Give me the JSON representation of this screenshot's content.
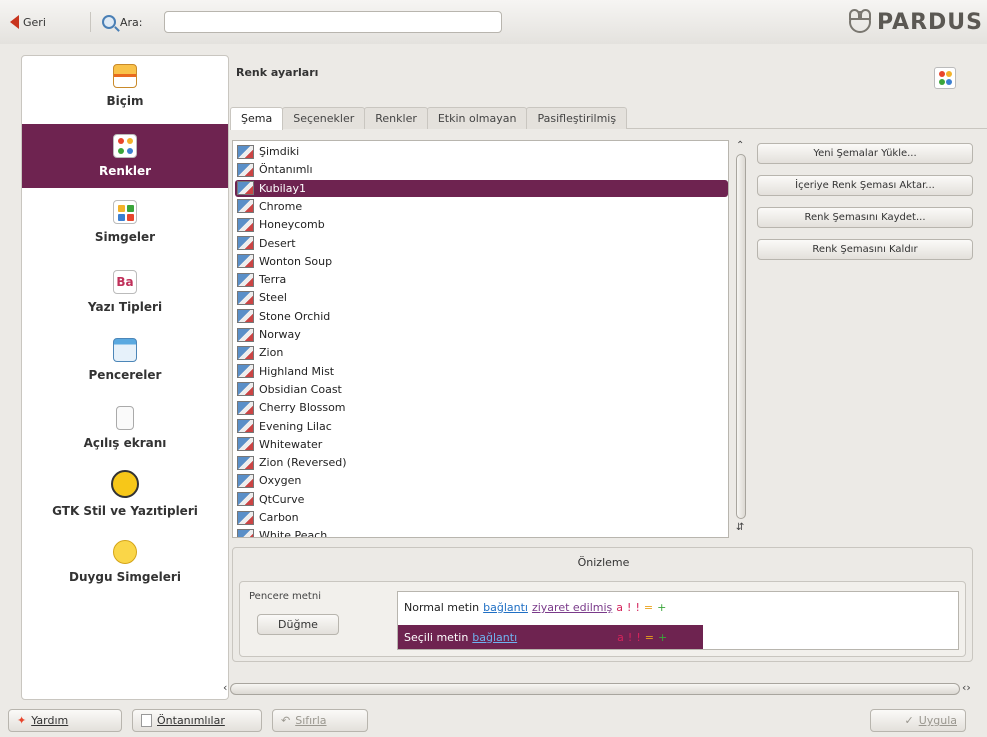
{
  "toolbar": {
    "back_label": "Geri",
    "search_label": "Ara:",
    "search_value": "",
    "brand": "PARDUS"
  },
  "sidebar": {
    "items": [
      {
        "label": "Biçim",
        "icon": "format-icon"
      },
      {
        "label": "Renkler",
        "icon": "colors-icon",
        "active": true
      },
      {
        "label": "Simgeler",
        "icon": "icons-icon"
      },
      {
        "label": "Yazı Tipleri",
        "icon": "fonts-icon"
      },
      {
        "label": "Pencereler",
        "icon": "windows-icon"
      },
      {
        "label": "Açılış ekranı",
        "icon": "splash-icon"
      },
      {
        "label": "GTK Stil ve Yazıtipleri",
        "icon": "gtk-icon"
      },
      {
        "label": "Duygu Simgeleri",
        "icon": "emoticons-icon"
      }
    ]
  },
  "main": {
    "title": "Renk ayarları",
    "tabs": [
      {
        "label": "Şema",
        "active": true
      },
      {
        "label": "Seçenekler"
      },
      {
        "label": "Renkler"
      },
      {
        "label": "Etkin olmayan"
      },
      {
        "label": "Pasifleştirilmiş"
      }
    ],
    "schemes": [
      "Şimdiki",
      "Öntanımlı",
      "Kubilay1",
      "Chrome",
      "Honeycomb",
      "Desert",
      "Wonton Soup",
      "Terra",
      "Steel",
      "Stone Orchid",
      "Norway",
      "Zion",
      "Highland Mist",
      "Obsidian Coast",
      "Cherry Blossom",
      "Evening Lilac",
      "Whitewater",
      "Zion (Reversed)",
      "Oxygen",
      "QtCurve",
      "Carbon",
      "White Peach"
    ],
    "selected_scheme": "Kubilay1",
    "actions": {
      "load": "Yeni Şemalar Yükle...",
      "import": "İçeriye Renk Şeması Aktar...",
      "save": "Renk Şemasını Kaydet...",
      "remove": "Renk Şemasını Kaldır"
    }
  },
  "preview": {
    "title": "Önizleme",
    "window_text_label": "Pencere metni",
    "button_label": "Düğme",
    "normal_text": "Normal metin",
    "link_text": "bağlantı",
    "visited_text": "ziyaret edilmiş",
    "marks": [
      "a",
      "!",
      "!",
      "=",
      "+"
    ],
    "selected_text": "Seçili metin",
    "selected_link": "bağlantı"
  },
  "bottom": {
    "help": "Yardım",
    "defaults": "Öntanımlılar",
    "reset": "Sıfırla",
    "apply": "Uygula"
  },
  "colors": {
    "accent": "#6e2350",
    "link": "#1f6fc4",
    "visited": "#7a3a8a"
  }
}
